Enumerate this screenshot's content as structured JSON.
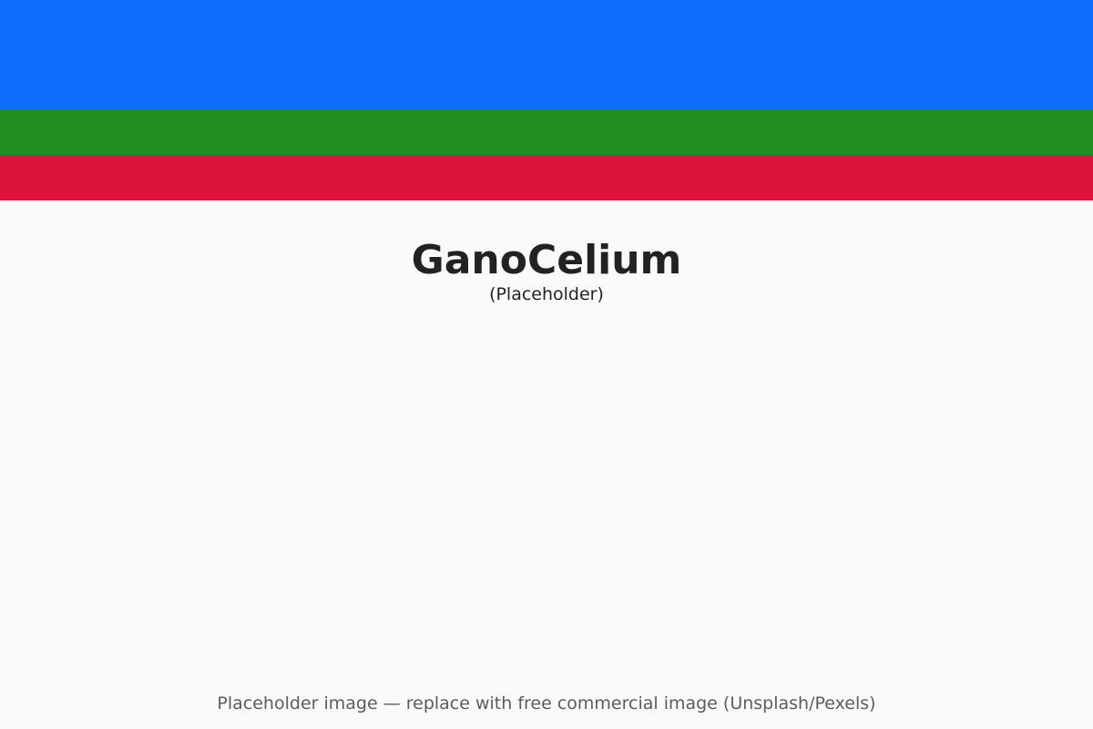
{
  "image": {
    "title": "GanoCelium",
    "subtitle": "(Placeholder)",
    "footer_note": "Placeholder image — replace with free commercial image (Unsplash/Pexels)"
  },
  "colors": {
    "background": "#fafafa",
    "band_blue": "#0d6efd",
    "band_green": "#228b22",
    "band_red": "#dc143c",
    "title_text": "#222222",
    "footer_text": "#5c5c5c"
  }
}
